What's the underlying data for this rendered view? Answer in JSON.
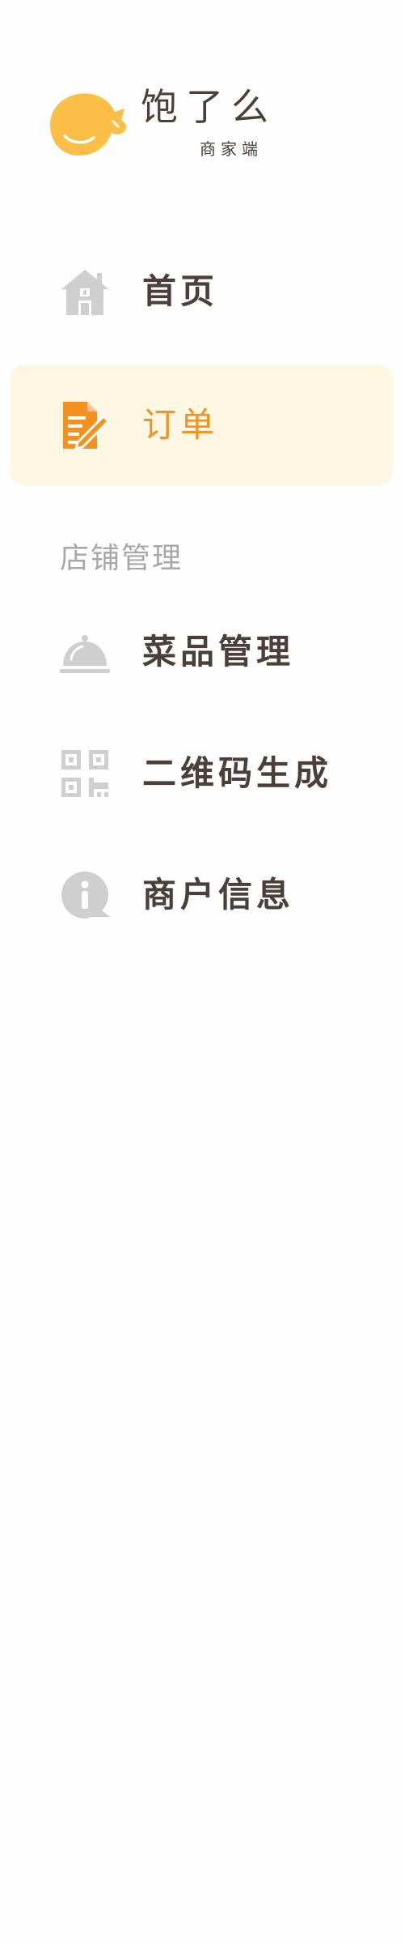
{
  "brand": {
    "name": "饱了么",
    "subtitle": "商家端",
    "logo_icon": "cat-bowl-logo-icon",
    "color": "#fbbf47"
  },
  "nav": {
    "items": [
      {
        "id": "home",
        "label": "首页",
        "icon": "house-icon",
        "active": false
      },
      {
        "id": "orders",
        "label": "订单",
        "icon": "order-edit-icon",
        "active": true
      }
    ]
  },
  "store_section": {
    "heading": "店铺管理",
    "items": [
      {
        "id": "dishes",
        "label": "菜品管理",
        "icon": "cloche-icon"
      },
      {
        "id": "qrcode",
        "label": "二维码生成",
        "icon": "qr-code-icon"
      },
      {
        "id": "merchant",
        "label": "商户信息",
        "icon": "info-bubble-icon"
      }
    ]
  },
  "colors": {
    "accent": "#f39221",
    "active_bg": "#fef7e3",
    "text_primary": "#4a3f3b",
    "text_muted": "#a8a8a8",
    "icon_gray": "#cfcfcf"
  }
}
